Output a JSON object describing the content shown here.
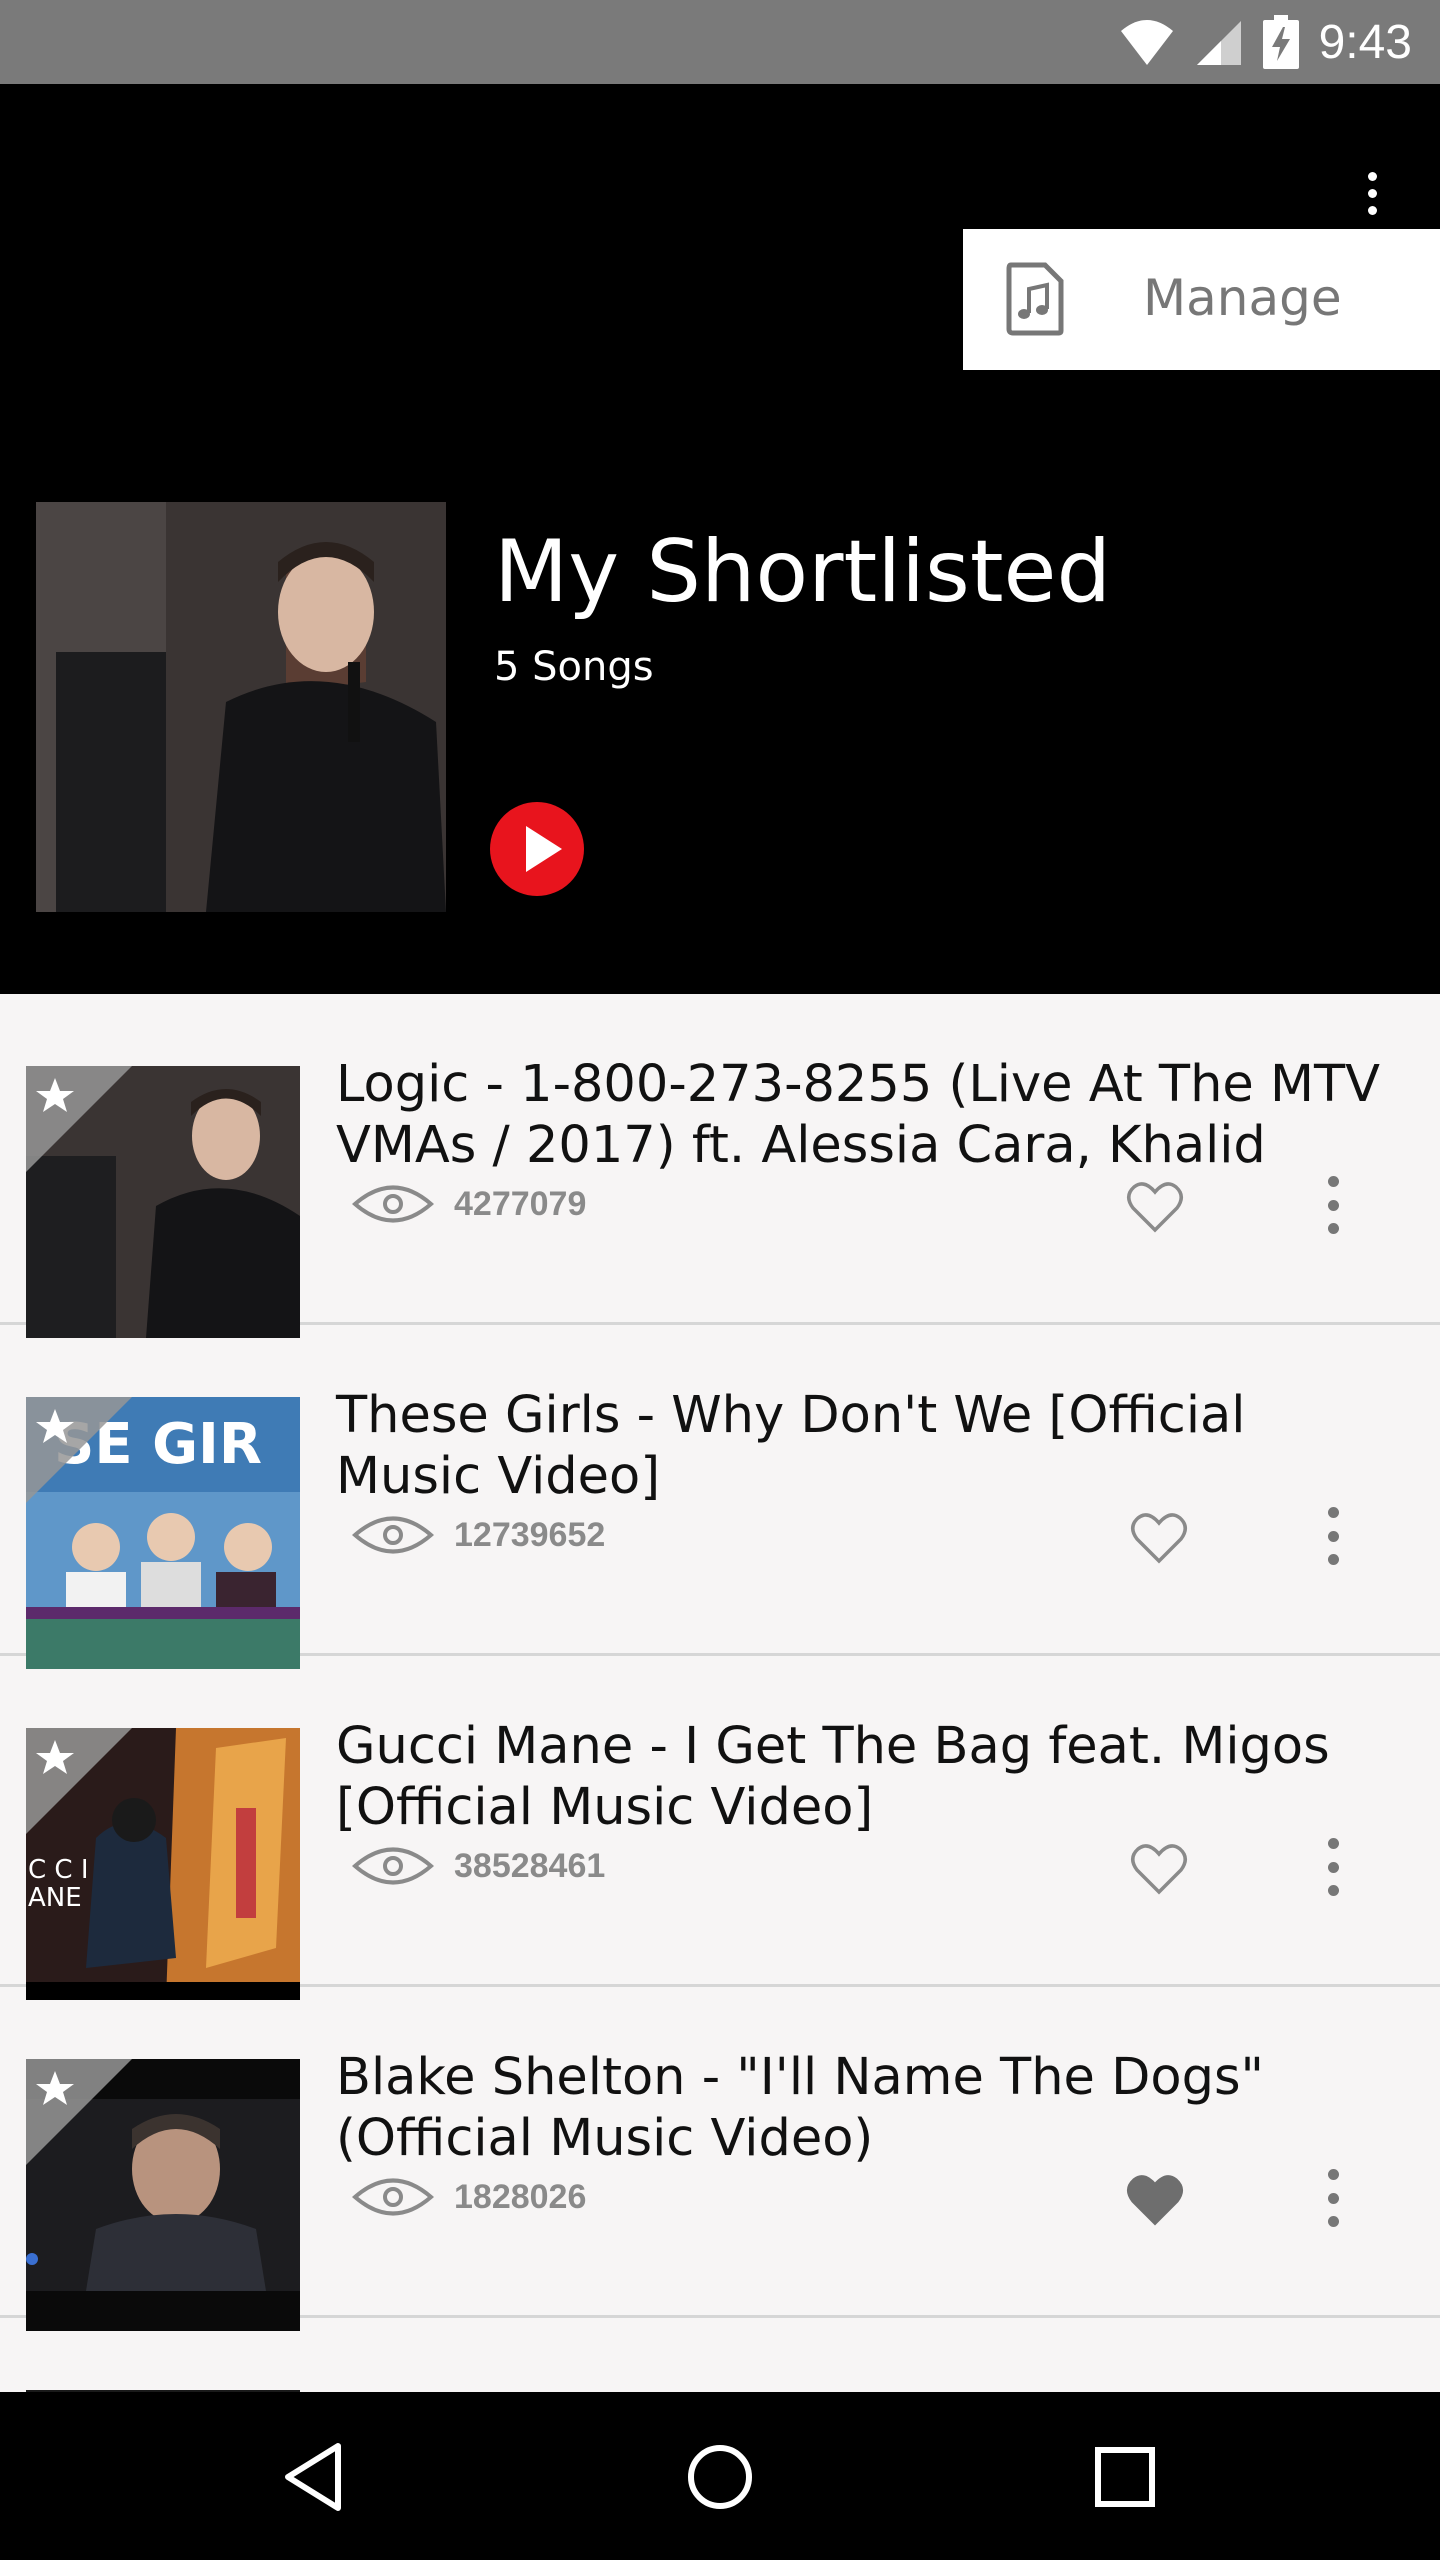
{
  "status_bar": {
    "time": "9:43",
    "icons": [
      "wifi-icon",
      "cell-signal-icon",
      "battery-charging-icon"
    ]
  },
  "header": {
    "overflow_icon": "more-vertical-icon",
    "menu": {
      "items": [
        {
          "label": "Manage",
          "icon": "music-file-icon"
        }
      ]
    },
    "playlist": {
      "title": "My Shortlisted",
      "count": "5 Songs",
      "play_color": "#e8141d"
    }
  },
  "songs": [
    {
      "title": "Logic - 1-800-273-8255 (Live At The MTV VMAs / 2017) ft. Alessia Cara, Khalid",
      "views": "4277079",
      "favorited": false
    },
    {
      "title": "These Girls - Why Don't We [Official Music Video]",
      "views": "12739652",
      "favorited": false,
      "thumb_text": "SE GIR"
    },
    {
      "title": "Gucci Mane - I Get The Bag feat. Migos [Official Music Video]",
      "views": "38528461",
      "favorited": false,
      "thumb_text": "C C I\nANE"
    },
    {
      "title": "Blake Shelton - \"I'll Name The Dogs\" (Official Music Video)",
      "views": "1828026",
      "favorited": true
    }
  ],
  "nav": {
    "items": [
      "back-icon",
      "home-icon",
      "recents-icon"
    ]
  }
}
